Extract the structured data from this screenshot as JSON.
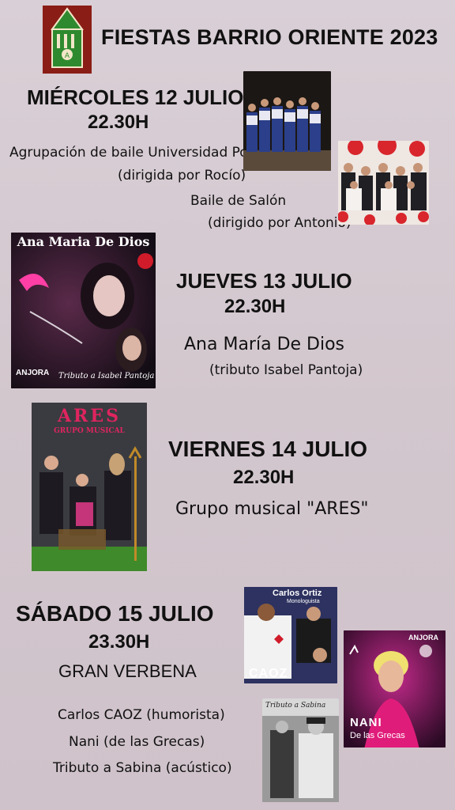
{
  "header": {
    "title": "FIESTAS BARRIO ORIENTE 2023"
  },
  "events": [
    {
      "day": "MIÉRCOLES 12 JULIO",
      "time": "22.30H",
      "acts": [
        {
          "line1": "Agrupación de baile Universidad Popular",
          "line2": "(dirigida por Rocío)"
        },
        {
          "line1": "Baile de Salón",
          "line2": "(dirigido por Antonio)"
        }
      ]
    },
    {
      "day": "JUEVES 13 JULIO",
      "time": "22.30H",
      "performer": "Ana María De Dios",
      "note": "(tributo Isabel Pantoja)",
      "poster": {
        "title": "Ana Maria De Dios",
        "brand": "ANJORA",
        "subtitle": "Tributo a Isabel Pantoja"
      }
    },
    {
      "day": "VIERNES 14 JULIO",
      "time": "22.30H",
      "performer": "Grupo musical \"ARES\"",
      "poster": {
        "title": "ARES",
        "subtitle": "GRUPO MUSICAL"
      }
    },
    {
      "day": "SÁBADO 15 JULIO",
      "time": "23.30H",
      "headline": "GRAN VERBENA",
      "acts": [
        "Carlos CAOZ (humorista)",
        "Nani (de las Grecas)",
        "Tributo a Sabina (acústico)"
      ],
      "posters": {
        "caoz": {
          "name": "Carlos Ortiz",
          "role": "Monologuista",
          "logo": "CAOZ"
        },
        "nani": {
          "brand": "ANJORA",
          "name": "NANI",
          "sub": "De las Grecas"
        },
        "sabina": {
          "title": "Tributo a Sabina"
        }
      }
    }
  ]
}
